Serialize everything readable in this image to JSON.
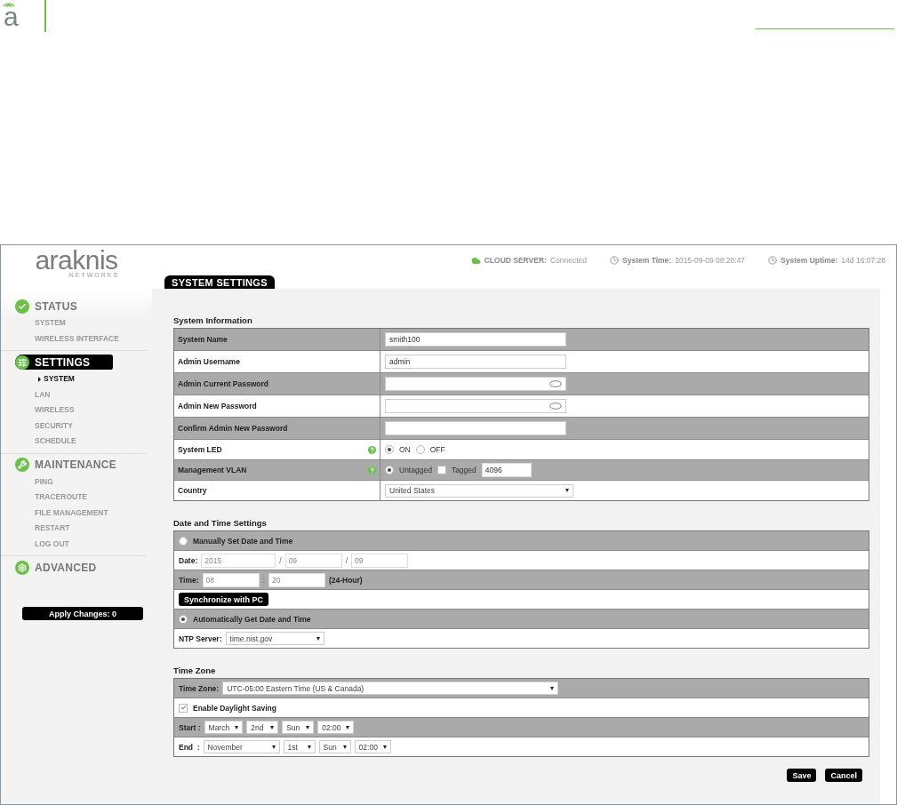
{
  "doc_header": {
    "logo_letter": "a"
  },
  "app": {
    "logo": {
      "name": "araknis",
      "tagline": "NETWORKS"
    },
    "status_bar": [
      {
        "label": "CLOUD SERVER:",
        "value": "Connected"
      },
      {
        "label": "System Time:",
        "value": "2015-09-09 08:20:47"
      },
      {
        "label": "System Uptime:",
        "value": "14d 16:07:28"
      }
    ],
    "sidebar": {
      "sections": [
        {
          "label": "STATUS",
          "selected": false,
          "items": [
            {
              "label": "SYSTEM",
              "selected": false
            },
            {
              "label": "WIRELESS INTERFACE",
              "selected": false
            }
          ]
        },
        {
          "label": "SETTINGS",
          "selected": true,
          "items": [
            {
              "label": "SYSTEM",
              "selected": true
            },
            {
              "label": "LAN",
              "selected": false
            },
            {
              "label": "WIRELESS",
              "selected": false
            },
            {
              "label": "SECURITY",
              "selected": false
            },
            {
              "label": "SCHEDULE",
              "selected": false
            }
          ]
        },
        {
          "label": "MAINTENANCE",
          "selected": false,
          "items": [
            {
              "label": "PING",
              "selected": false
            },
            {
              "label": "TRACEROUTE",
              "selected": false
            },
            {
              "label": "FILE MANAGEMENT",
              "selected": false
            },
            {
              "label": "RESTART",
              "selected": false
            },
            {
              "label": "LOG OUT",
              "selected": false
            }
          ]
        },
        {
          "label": "ADVANCED",
          "selected": false
        }
      ],
      "apply_button": "Apply Changes: 0"
    },
    "page_title": "SYSTEM SETTINGS",
    "system_information": {
      "title": "System Information",
      "rows": [
        {
          "kind": "text",
          "label": "System Name",
          "value": "smith100",
          "help": false
        },
        {
          "kind": "text",
          "label": "Admin Username",
          "value": "admin",
          "help": false
        },
        {
          "kind": "password",
          "label": "Admin Current Password",
          "help": false
        },
        {
          "kind": "password",
          "label": "Admin New Password",
          "help": false
        },
        {
          "kind": "text",
          "label": "Confirm Admin New Password",
          "help": false
        },
        {
          "kind": "radio",
          "label": "System LED",
          "help": true,
          "options": [
            {
              "label": "ON",
              "selected": true
            },
            {
              "label": "OFF",
              "selected": false
            }
          ]
        },
        {
          "kind": "vlan",
          "label": "Management VLAN",
          "help": true,
          "untagged": {
            "label": "Untagged",
            "selected": true
          },
          "tagged": {
            "label": "Tagged",
            "checked": false
          },
          "value": "4096"
        },
        {
          "kind": "select",
          "label": "Country",
          "value": "United States",
          "help": false
        }
      ]
    },
    "date_time": {
      "title": "Date and Time Settings",
      "rows": [
        {
          "kind": "radio_header",
          "label": "Manually Set Date and Time",
          "selected": false
        },
        {
          "kind": "inline",
          "label": "Date:",
          "parts": [
            {
              "kind": "input",
              "text": "2015"
            },
            {
              "kind": "sep",
              "text": "/"
            },
            {
              "kind": "input",
              "text": "09"
            },
            {
              "kind": "sep",
              "text": "/"
            },
            {
              "kind": "input",
              "text": "09"
            }
          ]
        },
        {
          "kind": "inline",
          "label": "Time:",
          "parts": [
            {
              "kind": "input",
              "text": "08"
            },
            {
              "kind": "sep",
              "text": ":"
            },
            {
              "kind": "input",
              "text": "20"
            },
            {
              "kind": "note",
              "text": "(24-Hour)"
            }
          ]
        },
        {
          "kind": "button",
          "label": "Synchronize with PC"
        },
        {
          "kind": "radio_header",
          "label": "Automatically Get Date and Time",
          "selected": true
        },
        {
          "kind": "inline",
          "label": "NTP Server:",
          "parts": [
            {
              "kind": "select",
              "text": "time.nist.gov"
            }
          ]
        }
      ]
    },
    "time_zone": {
      "title": "Time Zone",
      "rows": [
        {
          "kind": "inline",
          "label": "Time Zone:",
          "parts": [
            {
              "kind": "select",
              "text": "UTC-05:00 Eastern Time (US & Canada)",
              "wide": true
            }
          ]
        },
        {
          "kind": "check_header",
          "label": "Enable Daylight Saving",
          "checked": true
        },
        {
          "kind": "inline",
          "label": "Start :",
          "parts": [
            {
              "kind": "select",
              "text": "March"
            },
            {
              "kind": "select",
              "text": "2nd"
            },
            {
              "kind": "select",
              "text": "Sun"
            },
            {
              "kind": "select",
              "text": "02:00"
            }
          ]
        },
        {
          "kind": "inline",
          "label": "End  :",
          "parts": [
            {
              "kind": "select",
              "text": "November"
            },
            {
              "kind": "select",
              "text": "1st"
            },
            {
              "kind": "select",
              "text": "Sun"
            },
            {
              "kind": "select",
              "text": "02:00"
            }
          ]
        }
      ]
    },
    "buttons": [
      "Save",
      "Cancel"
    ]
  }
}
